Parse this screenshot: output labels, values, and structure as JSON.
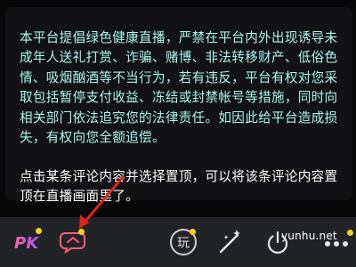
{
  "notice": {
    "text": "本平台提倡绿色健康直播，严禁在平台内外出现诱导未成年人送礼打赏、诈骗、赌博、非法转移财产、低俗色情、吸烟酗酒等不当行为，若有违反，平台有权对您采取包括暂停支付收益、冻结或封禁帐号等措施，同时向相关部门依法追究您的法律责任。如因此给平台造成损失，有权向您全额追偿。",
    "pin_instruction": "点击某条评论内容并选择置顶，可以将该条评论内容置顶在直播画面里了。"
  },
  "toolbar": {
    "pk_label": "PK",
    "play_label": "玩"
  },
  "watermark": "yunhu.net",
  "colors": {
    "notice_text": "#a9f7ec",
    "notification_dot": "#f5d218",
    "arrow": "#e0241b"
  }
}
